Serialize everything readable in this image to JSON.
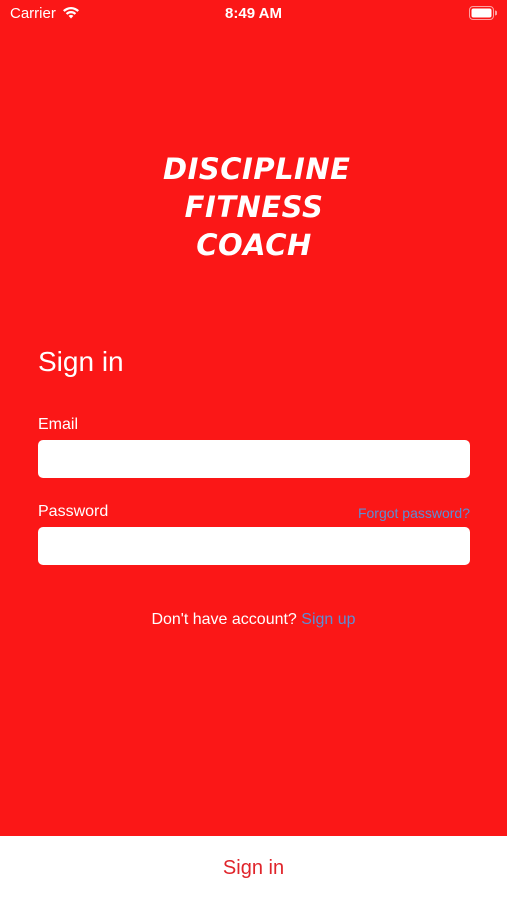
{
  "status_bar": {
    "carrier": "Carrier",
    "time": "8:49 AM"
  },
  "logo": {
    "line1": "DISCIPLINE",
    "line2": "FITNESS",
    "line3": "COACH"
  },
  "form": {
    "title": "Sign in",
    "email_label": "Email",
    "email_value": "",
    "password_label": "Password",
    "password_value": "",
    "forgot_password": "Forgot password?",
    "no_account_text": "Don't have account?",
    "sign_up_link": "Sign up"
  },
  "footer": {
    "sign_in_button": "Sign in"
  },
  "colors": {
    "background": "#fb1717",
    "link": "#5b8fd6",
    "button_text": "#e0242a"
  }
}
